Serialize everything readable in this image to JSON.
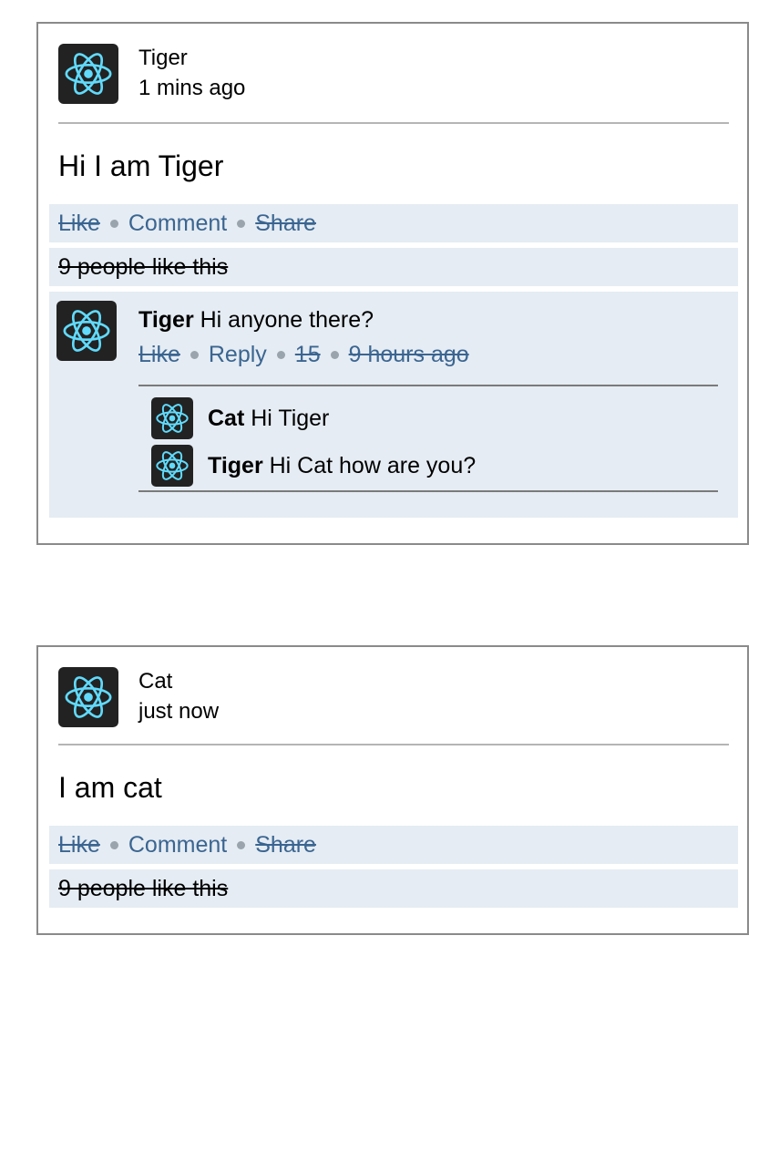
{
  "colors": {
    "link": "#3b6591",
    "action_bar_bg": "#e5ecf3",
    "avatar_bg": "#222222",
    "avatar_logo": "#61dafb",
    "card_border": "#8a8a8a"
  },
  "posts": [
    {
      "avatar_icon": "react-atom-icon",
      "author": "Tiger",
      "time": "1 mins ago",
      "body": "Hi I am Tiger",
      "actions": {
        "like": "Like",
        "comment": "Comment",
        "share": "Share"
      },
      "likes_text": "9 people like this",
      "comments": [
        {
          "avatar_icon": "react-atom-icon",
          "author": "Tiger",
          "text": "Hi anyone there?",
          "actions": {
            "like": "Like",
            "reply": "Reply",
            "count": "15",
            "time": "9 hours ago"
          },
          "replies": [
            {
              "avatar_icon": "react-atom-icon",
              "author": "Cat",
              "text": "Hi Tiger"
            },
            {
              "avatar_icon": "react-atom-icon",
              "author": "Tiger",
              "text": "Hi Cat how are you?"
            }
          ]
        }
      ]
    },
    {
      "avatar_icon": "react-atom-icon",
      "author": "Cat",
      "time": "just now",
      "body": "I am cat",
      "actions": {
        "like": "Like",
        "comment": "Comment",
        "share": "Share"
      },
      "likes_text": "9 people like this",
      "comments": []
    }
  ]
}
